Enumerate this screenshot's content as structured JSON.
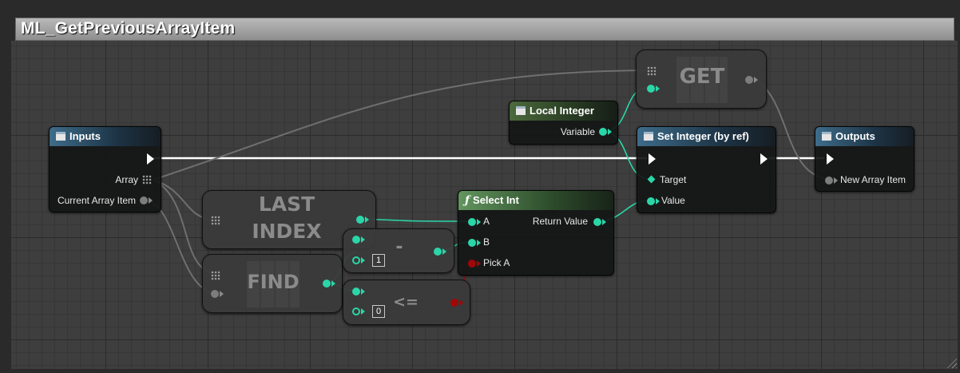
{
  "graph": {
    "title": "ML_GetPreviousArrayItem"
  },
  "nodes": {
    "inputs": {
      "title": "Inputs",
      "pins": [
        "Array",
        "Current Array Item"
      ]
    },
    "local_integer": {
      "title": "Local Integer",
      "pins": [
        "Variable"
      ]
    },
    "set_integer": {
      "title": "Set Integer (by ref)",
      "pins": [
        "Target",
        "Value"
      ]
    },
    "outputs": {
      "title": "Outputs",
      "pins": [
        "New Array Item"
      ]
    },
    "select_int": {
      "title": "Select Int",
      "icon": "function-icon",
      "inputs": [
        "A",
        "B",
        "Pick A"
      ],
      "output": "Return Value"
    },
    "get": {
      "label": "GET"
    },
    "last_index": {
      "label_line1": "LAST",
      "label_line2": "INDEX"
    },
    "find": {
      "label": "FIND"
    },
    "subtract": {
      "label": "-",
      "default_value": "1"
    },
    "less_equal": {
      "label": "<=",
      "default_value": "0"
    }
  },
  "colors": {
    "exec": "#ffffff",
    "integer_pin": "#2ad6a8",
    "bool_pin": "#a10707",
    "wildcard_pin": "#7d7d7d",
    "blue_header": "#3e6c8a",
    "function_header": "#62955f"
  }
}
